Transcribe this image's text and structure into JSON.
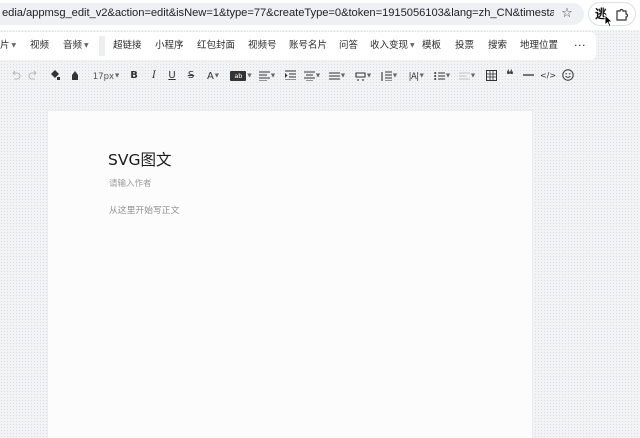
{
  "browser": {
    "url": "edia/appmsg_edit_v2&action=edit&isNew=1&type=77&createType=0&token=1915056103&lang=zh_CN&timestamp=1747581826626",
    "icons": [
      "star-icon",
      "extension-logo-icon",
      "puzzle-icon"
    ]
  },
  "insert_menu": {
    "items": [
      {
        "label": "片",
        "has_dropdown": true
      },
      {
        "label": "视频",
        "has_dropdown": false
      },
      {
        "label": "音频",
        "has_dropdown": true
      },
      {
        "label": "超链接",
        "has_dropdown": false
      },
      {
        "label": "小程序",
        "has_dropdown": false
      },
      {
        "label": "红包封面",
        "has_dropdown": false
      },
      {
        "label": "视频号",
        "has_dropdown": false
      },
      {
        "label": "账号名片",
        "has_dropdown": false
      },
      {
        "label": "问答",
        "has_dropdown": false
      },
      {
        "label": "收入变现",
        "has_dropdown": true
      },
      {
        "label": "模板",
        "has_dropdown": false
      },
      {
        "label": "投票",
        "has_dropdown": false
      },
      {
        "label": "搜索",
        "has_dropdown": false
      },
      {
        "label": "地理位置",
        "has_dropdown": false
      }
    ],
    "more_label": "···"
  },
  "format_toolbar": {
    "font_size": "17px",
    "bold": "B",
    "italic": "I",
    "underline": "U",
    "strikethrough": "S",
    "font_color": "A",
    "bg_color": "ab",
    "line_height": "|A|",
    "quote": "❝",
    "code": "</>",
    "icons": [
      "undo-icon",
      "redo-icon",
      "format-painter-icon",
      "clear-format-icon",
      "align-icon",
      "indent-icon",
      "justify-icon",
      "list-icon",
      "ordered-list-icon",
      "paragraph-spacing-icon",
      "divider-icon",
      "table-icon",
      "horizontal-rule-icon",
      "emoji-icon"
    ]
  },
  "editor": {
    "title": "SVG图文",
    "author_placeholder": "请输入作者",
    "body_placeholder": "从这里开始写正文"
  }
}
